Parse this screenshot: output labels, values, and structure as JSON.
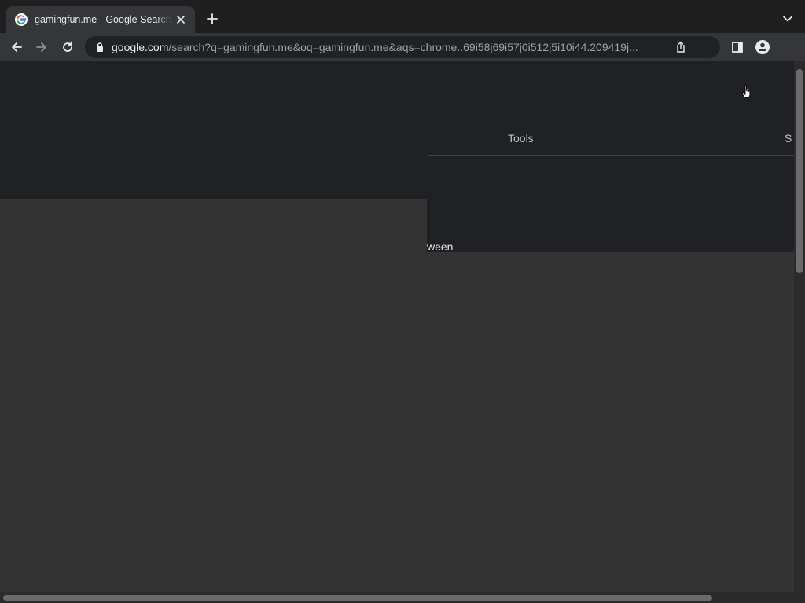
{
  "browser": {
    "tab": {
      "title": "gamingfun.me - Google Search",
      "favicon": "google-g-icon",
      "close_icon": "close-icon"
    },
    "new_tab_icon": "plus-icon",
    "tab_search_icon": "chevron-down-icon",
    "toolbar": {
      "back_icon": "arrow-left-icon",
      "forward_icon": "arrow-right-icon",
      "reload_icon": "reload-icon",
      "side_panel_icon": "side-panel-icon",
      "profile_icon": "profile-icon"
    },
    "omnibox": {
      "lock_icon": "lock-icon",
      "url_host": "google.com",
      "url_path": "/search?q=gamingfun.me&oq=gamingfun.me&aqs=chrome..69i58j69i57j0i512j5i10i44.209419j...",
      "share_icon": "share-icon"
    }
  },
  "page": {
    "tools_label": "Tools",
    "settings_label_partial": "S",
    "snippet_fragment": "ween",
    "overlay_color": "#333333",
    "background_color": "#202124"
  },
  "colors": {
    "tab_active": "#35363a",
    "tabstrip": "#1f1f1f",
    "text_primary": "#e8eaed",
    "text_secondary": "#9aa0a6"
  }
}
